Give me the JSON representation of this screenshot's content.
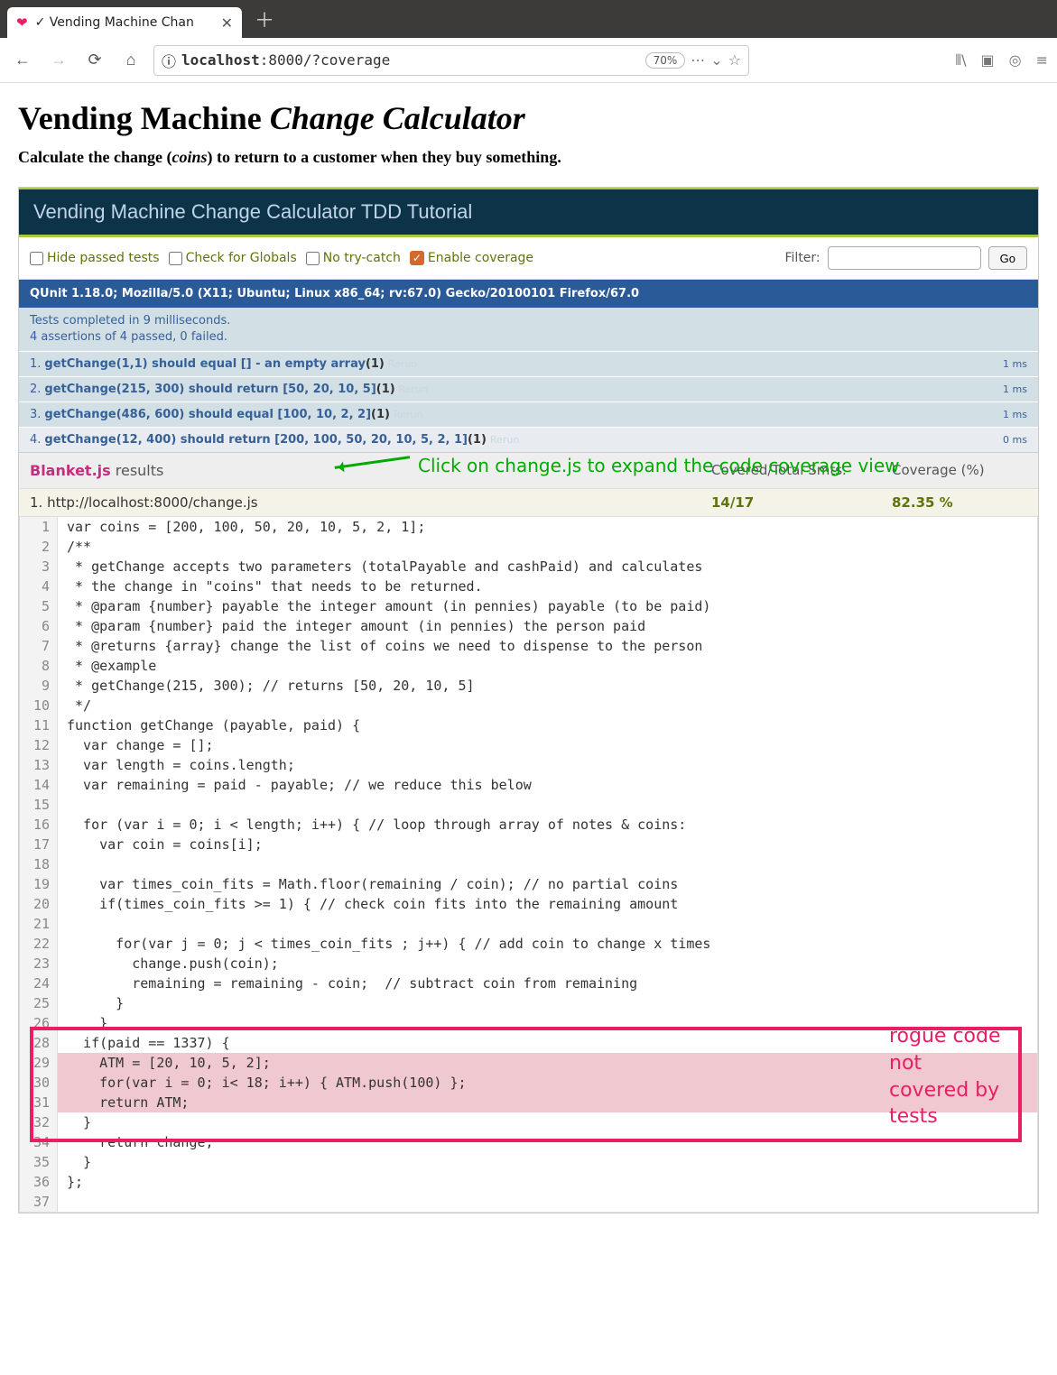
{
  "browser": {
    "tab_title": "✓ Vending Machine Chan",
    "url_prefix": "localhost",
    "url_path": ":8000/?coverage",
    "zoom": "70%"
  },
  "page": {
    "h1_a": "Vending Machine ",
    "h1_b": "Change Calculator",
    "tag_a": "Calculate the change (",
    "tag_b": "coins",
    "tag_c": ") to return to a customer when they buy something."
  },
  "qunit": {
    "header": "Vending Machine Change Calculator TDD Tutorial",
    "chk_hide": "Hide passed tests",
    "chk_globals": "Check for Globals",
    "chk_nocatch": "No try-catch",
    "chk_coverage": "Enable coverage",
    "filter_label": "Filter:",
    "go": "Go",
    "ua": "QUnit 1.18.0; Mozilla/5.0 (X11; Ubuntu; Linux x86_64; rv:67.0) Gecko/20100101 Firefox/67.0",
    "stats_a": "Tests completed in 9 milliseconds.",
    "stats_b": "4 assertions of 4 passed, 0 failed.",
    "tests": [
      {
        "n": "1.",
        "name": "getChange(1,1) should equal [] - an empty array",
        "count": "(1)",
        "rerun": "Rerun",
        "time": "1 ms"
      },
      {
        "n": "2.",
        "name": "getChange(215, 300) should return [50, 20, 10, 5]",
        "count": "(1)",
        "rerun": "Rerun",
        "time": "1 ms"
      },
      {
        "n": "3.",
        "name": "getChange(486, 600) should equal [100, 10, 2, 2]",
        "count": "(1)",
        "rerun": "Rerun",
        "time": "1 ms"
      },
      {
        "n": "4.",
        "name": "getChange(12, 400) should return [200, 100, 50, 20, 10, 5, 2, 1]",
        "count": "(1)",
        "rerun": "Rerun",
        "time": "0 ms"
      }
    ]
  },
  "blanket": {
    "label": "Blanket.js",
    "results": " results",
    "covered_hdr": "Covered/Total Smts.",
    "pct_hdr": "Coverage (%)",
    "file_num": "1.",
    "file": "http://localhost:8000/change.js",
    "stats": "14/17",
    "pct": "82.35 %",
    "callout": "Click on change.js to expand the code coverage view"
  },
  "rogue": "rogue code not covered by tests",
  "code": [
    {
      "n": 1,
      "t": "var coins = [200, 100, 50, 20, 10, 5, 2, 1];",
      "r": false
    },
    {
      "n": 2,
      "t": "/**",
      "r": false
    },
    {
      "n": 3,
      "t": " * getChange accepts two parameters (totalPayable and cashPaid) and calculates",
      "r": false
    },
    {
      "n": 4,
      "t": " * the change in \"coins\" that needs to be returned.",
      "r": false
    },
    {
      "n": 5,
      "t": " * @param {number} payable the integer amount (in pennies) payable (to be paid)",
      "r": false
    },
    {
      "n": 6,
      "t": " * @param {number} paid the integer amount (in pennies) the person paid",
      "r": false
    },
    {
      "n": 7,
      "t": " * @returns {array} change the list of coins we need to dispense to the person",
      "r": false
    },
    {
      "n": 8,
      "t": " * @example",
      "r": false
    },
    {
      "n": 9,
      "t": " * getChange(215, 300); // returns [50, 20, 10, 5]",
      "r": false
    },
    {
      "n": 10,
      "t": " */",
      "r": false
    },
    {
      "n": 11,
      "t": "function getChange (payable, paid) {",
      "r": false
    },
    {
      "n": 12,
      "t": "  var change = [];",
      "r": false
    },
    {
      "n": 13,
      "t": "  var length = coins.length;",
      "r": false
    },
    {
      "n": 14,
      "t": "  var remaining = paid - payable; // we reduce this below",
      "r": false
    },
    {
      "n": 15,
      "t": "",
      "r": false
    },
    {
      "n": 16,
      "t": "  for (var i = 0; i < length; i++) { // loop through array of notes & coins:",
      "r": false
    },
    {
      "n": 17,
      "t": "    var coin = coins[i];",
      "r": false
    },
    {
      "n": 18,
      "t": "",
      "r": false
    },
    {
      "n": 19,
      "t": "    var times_coin_fits = Math.floor(remaining / coin); // no partial coins",
      "r": false
    },
    {
      "n": 20,
      "t": "    if(times_coin_fits >= 1) { // check coin fits into the remaining amount",
      "r": false
    },
    {
      "n": 21,
      "t": "",
      "r": false
    },
    {
      "n": 22,
      "t": "      for(var j = 0; j < times_coin_fits ; j++) { // add coin to change x times",
      "r": false
    },
    {
      "n": 23,
      "t": "        change.push(coin);",
      "r": false
    },
    {
      "n": 24,
      "t": "        remaining = remaining - coin;  // subtract coin from remaining",
      "r": false
    },
    {
      "n": 25,
      "t": "      }",
      "r": false
    },
    {
      "n": 26,
      "t": "    }",
      "r": false
    },
    {
      "n": 28,
      "t": "  if(paid == 1337) {",
      "r": false
    },
    {
      "n": 29,
      "t": "    ATM = [20, 10, 5, 2];",
      "r": true
    },
    {
      "n": 30,
      "t": "    for(var i = 0; i< 18; i++) { ATM.push(100) };",
      "r": true
    },
    {
      "n": 31,
      "t": "    return ATM;",
      "r": true
    },
    {
      "n": 32,
      "t": "  }",
      "r": false
    },
    {
      "n": 34,
      "t": "    return change;",
      "r": false
    },
    {
      "n": 35,
      "t": "  }",
      "r": false
    },
    {
      "n": 36,
      "t": "};",
      "r": false
    },
    {
      "n": 37,
      "t": "",
      "r": false
    }
  ]
}
